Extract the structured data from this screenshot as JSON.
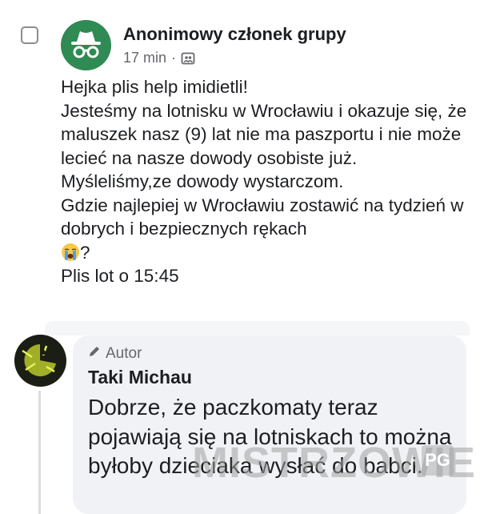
{
  "post": {
    "author": "Anonimowy członek grupy",
    "time": "17 min",
    "separator": "·",
    "audience_icon": "group-audience-icon",
    "lines": [
      "Hejka plis help imidietli!",
      "Jesteśmy na lotnisku w Wrocławiu i okazuje się, że maluszek nasz (9) lat nie ma paszportu i nie może lecieć na nasze dowody osobiste już. Myśleliśmy,ze dowody wystarczom.",
      "Gdzie najlepiej w Wrocławiu zostawić na tydzień w dobrych i bezpiecznych rękach",
      "?",
      "Plis lot o 15:45"
    ],
    "emoji": "crying-face"
  },
  "comment": {
    "badge": "Autor",
    "author": "Taki Michau",
    "text": "Dobrze, że paczkomaty teraz pojawiają się na lotniskach to można byłoby dzieciaka wysłać do babci."
  },
  "watermark": {
    "text": "MISTRZOWIE",
    "suffix": "PG"
  },
  "colors": {
    "avatar_green": "#2f8a53",
    "bubble_bg": "#f0f2f5",
    "muted_text": "#65676b"
  }
}
